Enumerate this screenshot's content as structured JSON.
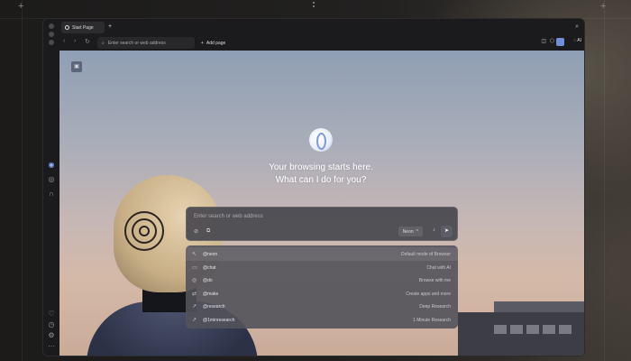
{
  "tab": {
    "label": "Start Page",
    "add": "+"
  },
  "address": {
    "placeholder": "Enter search or web address",
    "add_page": "Add page",
    "ai": "AI"
  },
  "start": {
    "headline_1": "Your browsing starts here.",
    "headline_2": "What can I do for you?",
    "search_placeholder": "Enter search or web address",
    "mode": "Neon"
  },
  "suggestions": [
    {
      "cmd": "@neon",
      "desc": "Default mode of Browser",
      "icon": "cursor-icon"
    },
    {
      "cmd": "@chat",
      "desc": "Chat with AI",
      "icon": "chat-icon"
    },
    {
      "cmd": "@do",
      "desc": "Browse with me",
      "icon": "browse-icon"
    },
    {
      "cmd": "@make",
      "desc": "Create apps and more",
      "icon": "shuffle-icon"
    },
    {
      "cmd": "@research",
      "desc": "Deep Research",
      "icon": "research-icon"
    },
    {
      "cmd": "@1minresearch",
      "desc": "1 Minute Research",
      "icon": "quick-research-icon"
    }
  ]
}
